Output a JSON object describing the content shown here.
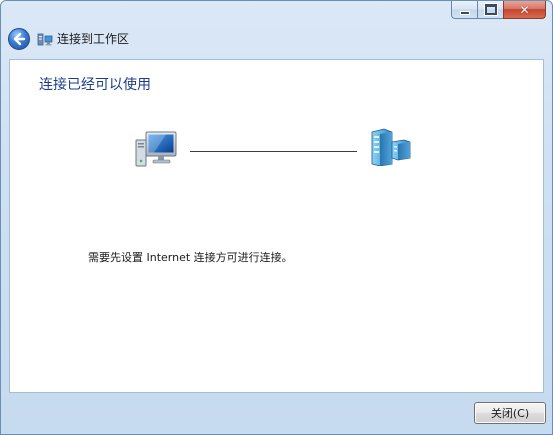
{
  "window": {
    "title": "连接到工作区",
    "caption_buttons": {
      "close_glyph": "✕"
    }
  },
  "content": {
    "heading": "连接已经可以使用",
    "message": "需要先设置 Internet 连接方可进行连接。"
  },
  "footer": {
    "close_label": "关闭(C)"
  },
  "icons": {
    "back": "back-arrow-icon",
    "title": "network-connection-icon",
    "computer": "computer-icon",
    "server": "server-icon"
  },
  "colors": {
    "heading": "#1c3d8c",
    "frame": "#cfe0f3",
    "close_caption": "#c7432c"
  }
}
